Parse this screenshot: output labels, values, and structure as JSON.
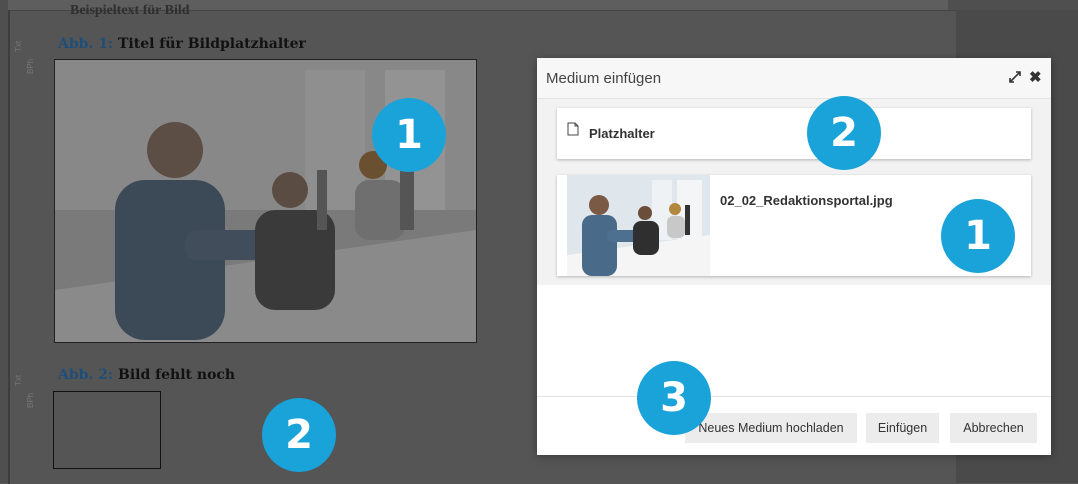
{
  "document": {
    "cut_heading": "Beispieltext für Bild",
    "side_label_1": "Txt",
    "side_label_2": "BPh",
    "figure1": {
      "prefix": "Abb. 1:",
      "title": "Titel für Bildplatzhalter"
    },
    "figure2": {
      "prefix": "Abb. 2:",
      "title": "Bild fehlt noch"
    }
  },
  "badges": {
    "doc_image": "1",
    "doc_placeholder": "2",
    "modal_image": "1",
    "modal_placeholder": "2",
    "upload": "3"
  },
  "modal": {
    "title": "Medium einfügen",
    "expand_icon": "expand-icon",
    "close_icon": "close-icon",
    "close_glyph": "✖",
    "items": [
      {
        "type": "placeholder",
        "icon": "document-icon",
        "label": "Platzhalter"
      },
      {
        "type": "image",
        "label": "02_02_Redaktionsportal.jpg"
      }
    ],
    "buttons": {
      "upload": "Neues Medium hochladen",
      "insert": "Einfügen",
      "cancel": "Abbrechen"
    }
  },
  "colors": {
    "badge": "#1aa3d9",
    "caption_prefix": "#1d4f7a"
  }
}
